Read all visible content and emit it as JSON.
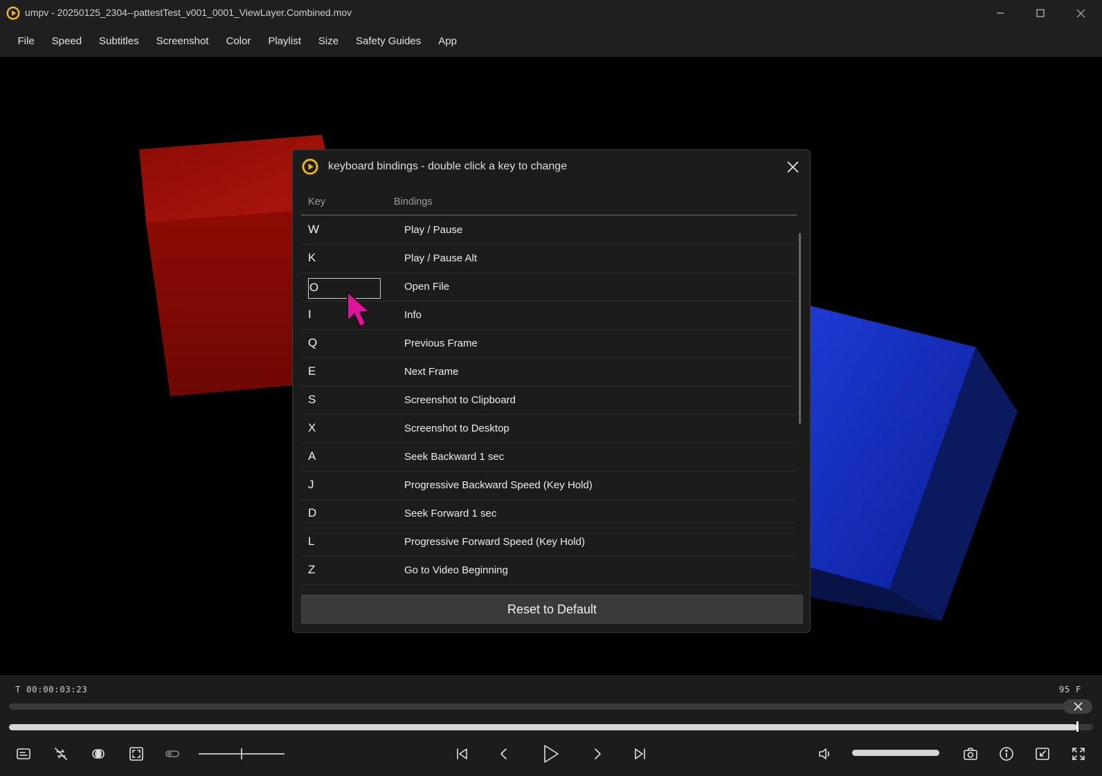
{
  "window": {
    "title": "umpv - 20250125_2304--pattestTest_v001_0001_ViewLayer.Combined.mov",
    "logo_icon": "play-circle-icon",
    "accent_color": "#f2b90f"
  },
  "menu": {
    "items": [
      "File",
      "Speed",
      "Subtitles",
      "Screenshot",
      "Color",
      "Playlist",
      "Size",
      "Safety Guides",
      "App"
    ]
  },
  "dialog": {
    "title": "keyboard bindings - double click a key to change",
    "col_key": "Key",
    "col_bindings": "Bindings",
    "rows": [
      {
        "key": "W",
        "binding": "Play / Pause"
      },
      {
        "key": "K",
        "binding": "Play / Pause Alt"
      },
      {
        "key": "O",
        "binding": "Open File",
        "editing": true
      },
      {
        "key": "I",
        "binding": "Info"
      },
      {
        "key": "Q",
        "binding": "Previous Frame"
      },
      {
        "key": "E",
        "binding": "Next Frame"
      },
      {
        "key": "S",
        "binding": "Screenshot to Clipboard"
      },
      {
        "key": "X",
        "binding": "Screenshot to Desktop"
      },
      {
        "key": "A",
        "binding": "Seek Backward 1 sec"
      },
      {
        "key": "J",
        "binding": "Progressive Backward Speed (Key Hold)"
      },
      {
        "key": "D",
        "binding": "Seek Forward 1 sec"
      },
      {
        "key": "L",
        "binding": "Progressive Forward Speed (Key Hold)"
      },
      {
        "key": "Z",
        "binding": "Go to Video Beginning"
      }
    ],
    "reset_label": "Reset to Default"
  },
  "controls": {
    "timecode": "T  00:00:03:23",
    "frame": "95  F",
    "playback_progress": 0.985,
    "volume_level": 1.0
  }
}
